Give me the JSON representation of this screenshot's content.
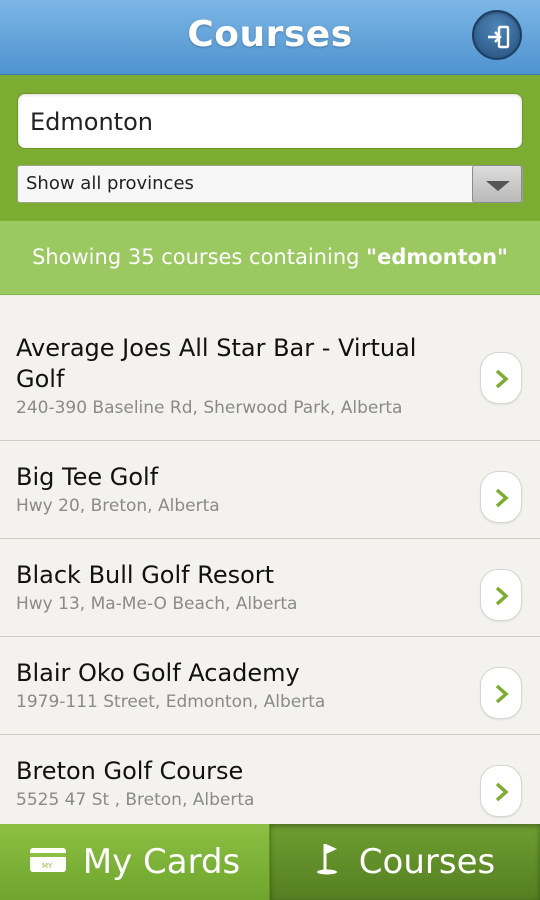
{
  "header": {
    "title": "Courses",
    "logout_icon": "logout-icon"
  },
  "search": {
    "value": "Edmonton",
    "province_selected": "Show all provinces"
  },
  "status": {
    "prefix": "Showing 35 courses containing ",
    "query": "\"edmonton\""
  },
  "courses": [
    {
      "name": "Average Joes All Star Bar - Virtual Golf",
      "address": "240-390 Baseline Rd, Sherwood Park, Alberta"
    },
    {
      "name": "Big Tee Golf",
      "address": "Hwy 20, Breton, Alberta"
    },
    {
      "name": "Black Bull Golf Resort",
      "address": "Hwy 13, Ma-Me-O Beach, Alberta"
    },
    {
      "name": "Blair Oko Golf Academy",
      "address": "1979-111 Street, Edmonton, Alberta"
    },
    {
      "name": "Breton Golf Course",
      "address": "5525 47 St , Breton, Alberta"
    }
  ],
  "tabs": {
    "cards_label": "My Cards",
    "courses_label": "Courses",
    "cards_icon": "card-icon",
    "courses_icon": "golf-flag-icon",
    "active": "Courses"
  },
  "colors": {
    "header_blue": "#5a9bd4",
    "green": "#7dac33",
    "status_green": "#9cc862"
  }
}
